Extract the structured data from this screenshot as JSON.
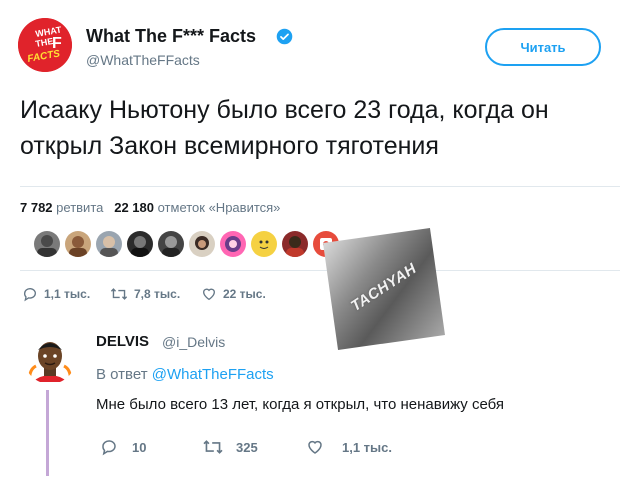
{
  "tweet": {
    "author_name": "What The F*** Facts",
    "author_handle": "@WhatTheFFacts",
    "avatar_logo_text": [
      "WHAT",
      "THE",
      "F",
      "FACTS"
    ],
    "follow_label": "Читать",
    "text": "Исааку Ньютону было всего 23 года, когда он открыл Закон всемирного тяготения",
    "retweets_count": "7 782",
    "retweets_label": "ретвита",
    "likes_count": "22 180",
    "likes_label": "отметок «Нравится»",
    "actions": {
      "reply_count": "1,1 тыс.",
      "retweet_count": "7,8 тыс.",
      "like_count": "22 тыс."
    }
  },
  "watermark": {
    "text": "TACHYAH"
  },
  "reply": {
    "author_name": "DELVIS",
    "author_handle": "@i_Delvis",
    "in_reply_prefix": "В ответ",
    "in_reply_handle": "@WhatTheFFacts",
    "text": "Мне было всего 13 лет, когда я открыл, что ненавижу себя",
    "actions": {
      "reply_count": "10",
      "retweet_count": "325",
      "like_count": "1,1 тыс."
    }
  },
  "colors": {
    "accent": "#1da1f2",
    "brand_red": "#e0232b",
    "muted": "#657786",
    "thread_line": "#c4a7d6"
  }
}
